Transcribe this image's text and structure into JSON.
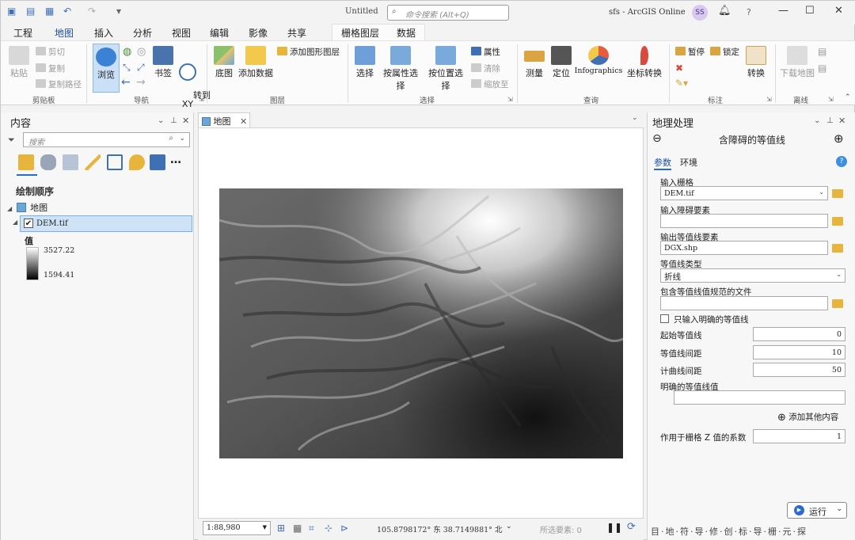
{
  "quick_access": {
    "undo_icon": "undo-arrow-icon",
    "redo_icon": "redo-arrow-icon"
  },
  "titlebar": {
    "doc_title": "Untitled",
    "search_placeholder": "命令搜索 (Alt+Q)",
    "project_name": "sfs - ArcGIS Online",
    "avatar_initials": "SS",
    "help": "?"
  },
  "tabs": [
    "工程",
    "地图",
    "插入",
    "分析",
    "视图",
    "编辑",
    "影像",
    "共享"
  ],
  "active_tab": "地图",
  "context_tabs": [
    "栅格图层",
    "数据"
  ],
  "ribbon": {
    "clipboard": {
      "paste": "粘贴",
      "cut": "剪切",
      "copy": "复制",
      "copy_path": "复制路径",
      "label": "剪贴板"
    },
    "navigate": {
      "explore": "浏览",
      "bookmarks": "书签",
      "goto": "转到\nXY",
      "label": "导航"
    },
    "layer": {
      "basemap": "底图",
      "add_data": "添加数据",
      "add_graphics": "添加图形图层",
      "label": "图层"
    },
    "selection": {
      "select": "选择",
      "by_attr": "按属性选择",
      "by_loc": "按位置选择",
      "attributes": "属性",
      "clear": "清除",
      "zoom_to": "缩放至",
      "label": "选择"
    },
    "inquiry": {
      "measure": "测量",
      "locate": "定位",
      "infographics": "Infographics",
      "coord": "坐标转换",
      "label": "查询"
    },
    "labeling": {
      "pause": "暂停",
      "lock": "锁定",
      "convert": "转换",
      "label": "标注"
    },
    "offline": {
      "download": "下载地图",
      "label": "离线"
    }
  },
  "contents": {
    "title": "内容",
    "search_placeholder": "搜索",
    "section": "绘制顺序",
    "map": "地图",
    "layer": "DEM.tif",
    "legend_title": "值",
    "legend_max": "3527.22",
    "legend_min": "1594.41"
  },
  "mapview": {
    "tab": "地图",
    "scale": "1:88,980",
    "coords": "105.8798172° 东  38.7149881° 北",
    "selected": "所选要素: 0"
  },
  "gp": {
    "title": "地理处理",
    "tool": "含障碍的等值线",
    "tab_params": "参数",
    "tab_env": "环境",
    "in_raster_label": "输入栅格",
    "in_raster": "DEM.tif",
    "barrier_label": "输入障碍要素",
    "barrier": "",
    "out_label": "输出等值线要素",
    "out": "DGX.shp",
    "type_label": "等值线类型",
    "type": "折线",
    "spec_label": "包含等值线值规范的文件",
    "spec": "",
    "explicit_only": "只输入明确的等值线",
    "base_label": "起始等值线",
    "base": "0",
    "interval_label": "等值线间距",
    "interval": "10",
    "index_label": "计曲线间距",
    "index": "50",
    "explicit_label": "明确的等值线值",
    "add_more": "添加其他内容",
    "z_label": "作用于栅格 Z 值的系数",
    "z": "1",
    "run": "运行",
    "bottom_tabs": "目·地·符·导·修·创·标·导·栅·元·探"
  }
}
